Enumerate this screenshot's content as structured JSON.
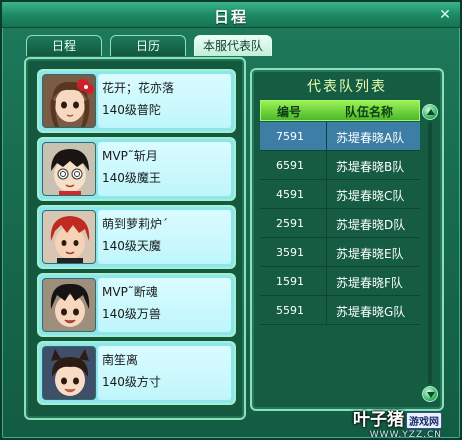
{
  "window": {
    "title": "日程",
    "close_symbol": "✕"
  },
  "tabs": [
    {
      "label": "日程",
      "active": false
    },
    {
      "label": "日历",
      "active": false
    },
    {
      "label": "本服代表队",
      "active": true
    }
  ],
  "members": [
    {
      "name": "花开；花亦落",
      "level": "140级普陀",
      "avatar": "girl-avatar-red-bow"
    },
    {
      "name": "MVP˜斩月",
      "level": "140级魔王",
      "avatar": "boy-avatar-dizzy"
    },
    {
      "name": "萌到萝莉炉ˊ",
      "level": "140级天魔",
      "avatar": "boy-avatar-red-hair"
    },
    {
      "name": "MVP˜断魂",
      "level": "140级万兽",
      "avatar": "boy-avatar-black-hair"
    },
    {
      "name": "南笙离",
      "level": "140级方寸",
      "avatar": "girl-avatar-cat-ears"
    }
  ],
  "team_list": {
    "title": "代表队列表",
    "col_id": "编号",
    "col_team": "队伍名称",
    "rows": [
      {
        "id": "7591",
        "team": "苏堤春晓A队",
        "selected": true
      },
      {
        "id": "6591",
        "team": "苏堤春晓B队",
        "selected": false
      },
      {
        "id": "4591",
        "team": "苏堤春晓C队",
        "selected": false
      },
      {
        "id": "2591",
        "team": "苏堤春晓D队",
        "selected": false
      },
      {
        "id": "3591",
        "team": "苏堤春晓E队",
        "selected": false
      },
      {
        "id": "1591",
        "team": "苏堤春晓F队",
        "selected": false
      },
      {
        "id": "5591",
        "team": "苏堤春晓G队",
        "selected": false
      }
    ]
  },
  "watermark": {
    "text": "叶子猪",
    "badge": "游戏网",
    "url": "WWW.YZZ.CN"
  },
  "colors": {
    "accent": "#1f7a5c",
    "selected_row": "#3c7ea6",
    "header_green": "#4cb82a",
    "card_cyan": "#8ce6f0"
  }
}
